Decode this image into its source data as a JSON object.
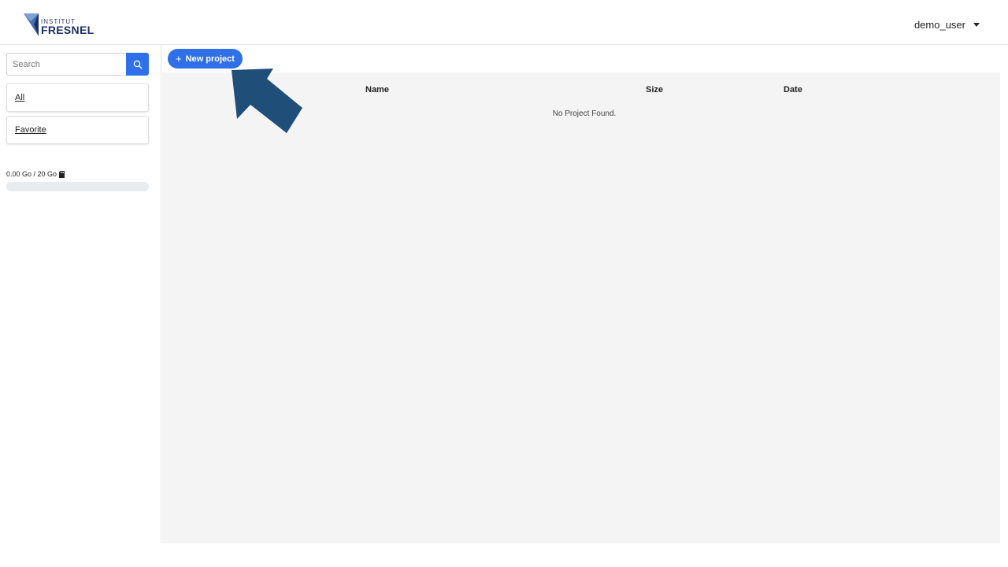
{
  "header": {
    "logo": {
      "top_text": "INSTITUT",
      "main_text": "FRESNEL"
    },
    "user_name": "demo_user"
  },
  "sidebar": {
    "search": {
      "placeholder": "Search",
      "value": ""
    },
    "filters": [
      {
        "label": "All"
      },
      {
        "label": "Favorite"
      }
    ],
    "storage": {
      "label": "0.00 Go / 20 Go",
      "used_fraction": 0.0
    }
  },
  "main": {
    "new_project_label": "New project",
    "table": {
      "columns": [
        "Name",
        "Size",
        "Date"
      ],
      "empty_message": "No Project Found."
    }
  },
  "colors": {
    "accent": "#2f6fe8",
    "arrow": "#1f4e79",
    "table_bg": "#f4f4f4"
  }
}
